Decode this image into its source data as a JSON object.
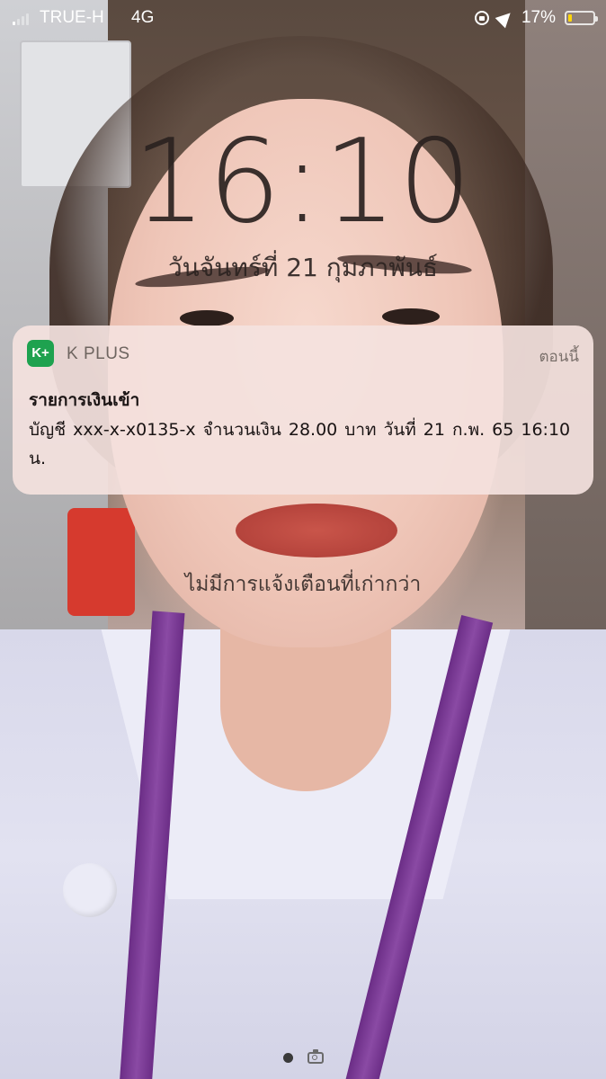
{
  "status_bar": {
    "carrier": "TRUE-H",
    "network": "4G",
    "battery_percent_label": "17%",
    "battery_level": 0.17,
    "signal_bars_active": 1,
    "signal_bars_total": 4,
    "icons": [
      "signal-icon",
      "rotation-lock-icon",
      "location-icon",
      "battery-icon"
    ],
    "battery_color": "#ffd60a"
  },
  "lock_screen": {
    "time": "16:10",
    "date": "วันจันทร์ที่ 21 กุมภาพันธ์",
    "no_older_notifications": "ไม่มีการแจ้งเตือนที่เก่ากว่า"
  },
  "notification": {
    "app_icon_text": "K+",
    "app_icon_color": "#1ea24f",
    "app_name": "K PLUS",
    "time": "ตอนนี้",
    "title": "รายการเงินเข้า",
    "body": "บัญชี xxx-x-x0135-x  จำนวนเงิน 28.00 บาท  วันที่ 21 ก.พ. 65  16:10 น."
  },
  "bottom": {
    "icons": [
      "page-dot-icon",
      "camera-icon"
    ]
  }
}
